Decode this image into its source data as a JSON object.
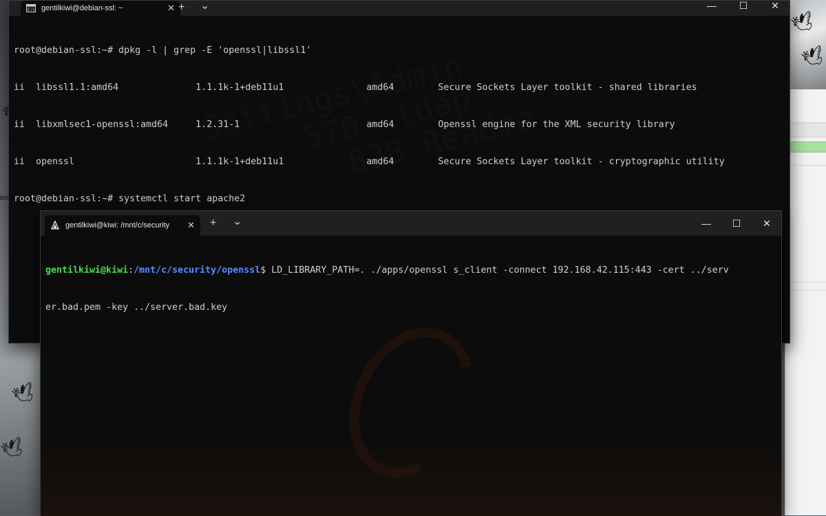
{
  "desktop": {
    "language_indicator": "en"
  },
  "back_terminal": {
    "tab_title": "gentilkiwi@debian-ssl: ~",
    "tab_icon": "cmd-icon",
    "lines": [
      "root@debian-ssl:~# dpkg -l | grep -E 'openssl|libssl1'",
      "ii  libssl1.1:amd64              1.1.1k-1+deb11u1               amd64        Secure Sockets Layer toolkit - shared libraries",
      "ii  libxmlsec1-openssl:amd64     1.2.31-1                       amd64        Openssl engine for the XML security library",
      "ii  openssl                      1.1.1k-1+deb11u1               amd64        Secure Sockets Layer toolkit - cryptographic utility",
      "root@debian-ssl:~# systemctl start apache2"
    ]
  },
  "front_terminal": {
    "tab_title": "gentilkiwi@kiwi: /mnt/c/security",
    "tab_icon": "debian-icon",
    "prompt_user": "gentilkiwi@kiwi",
    "prompt_colon": ":",
    "prompt_path": "/mnt/c/security/openssl",
    "prompt_dollar": "$ ",
    "command_line1": "LD_LIBRARY_PATH=. ./apps/openssl s_client -connect 192.168.42.115:443 -cert ../serv",
    "command_line2": "er.bad.pem -key ../server.bad.key"
  },
  "window_controls": {
    "minimize": "—",
    "maximize": "☐",
    "close": "✕",
    "new_tab": "+",
    "dropdown": "⌄",
    "tab_close": "✕"
  },
  "colors": {
    "terminal_bg": "#0c0c0c",
    "tabbar_bg": "#202020",
    "prompt_user": "#4fdc4f",
    "prompt_path": "#5a8cff",
    "text": "#d0d0d0"
  }
}
